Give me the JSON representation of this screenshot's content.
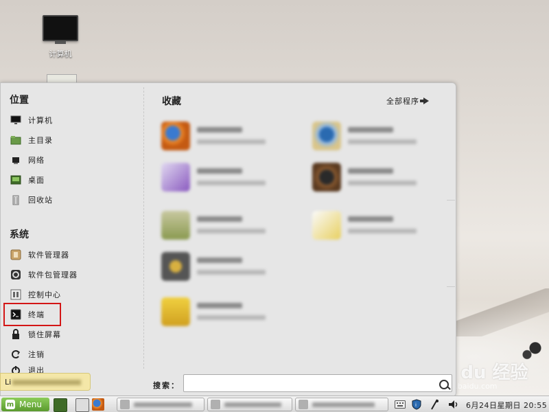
{
  "desktop": {
    "computer_icon_label": "计算机"
  },
  "menu": {
    "places_title": "位置",
    "places": [
      {
        "label": "计算机",
        "icon": "computer-icon"
      },
      {
        "label": "主目录",
        "icon": "home-folder-icon"
      },
      {
        "label": "网络",
        "icon": "network-icon"
      },
      {
        "label": "桌面",
        "icon": "desktop-icon"
      },
      {
        "label": "回收站",
        "icon": "trash-icon"
      }
    ],
    "system_title": "系统",
    "system": [
      {
        "label": "软件管理器",
        "icon": "software-manager-icon"
      },
      {
        "label": "软件包管理器",
        "icon": "package-manager-icon"
      },
      {
        "label": "控制中心",
        "icon": "control-center-icon"
      },
      {
        "label": "终端",
        "icon": "terminal-icon"
      },
      {
        "label": "锁住屏幕",
        "icon": "lock-icon"
      },
      {
        "label": "注销",
        "icon": "logout-icon"
      },
      {
        "label": "退出",
        "icon": "power-icon"
      }
    ],
    "favorites_title": "收藏",
    "all_programs_label": "全部程序",
    "search_label": "搜索：",
    "search_value": "",
    "colors": {
      "highlight_box": "#d31515"
    }
  },
  "tooltip": {
    "prefix": "Li"
  },
  "taskbar": {
    "start_label": "Menu",
    "clock": "6月24日星期日 20:55"
  },
  "watermark": {
    "brand": "Bai du 经验",
    "url": "jingyan.baidu.com"
  }
}
